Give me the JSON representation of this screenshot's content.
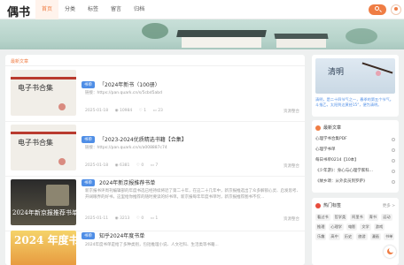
{
  "header": {
    "logo": "偶书",
    "nav": [
      "首页",
      "分类",
      "标签",
      "留言",
      "归档"
    ],
    "search_icon": "search-icon",
    "avatar_icon": "user-icon",
    "accent": "#ef7d44"
  },
  "main": {
    "section_title": "最新文章",
    "posts": [
      {
        "thumb_text": "电子书合集",
        "category": "书单",
        "title": "「2024年新书（100册）",
        "desc": "链接：https://pan.quark.cn/s/5cbd5abd",
        "date": "2025-01-18",
        "views": "10984",
        "likes": "1",
        "comments": "23",
        "source": "资源整合"
      },
      {
        "thumb_text": "电子书合集",
        "category": "书单",
        "title": "「2023-2024优质精选书籍【合集】",
        "desc": "链接：https://pan.quark.cn/s/a008887c74",
        "date": "2025-01-18",
        "views": "6381",
        "likes": "0",
        "comments": "7",
        "source": "资源整合"
      },
      {
        "thumb_text": "2024年新京报推荐书单",
        "category": "书单",
        "title": "2024年新京报推荐书单",
        "desc": "新京报书评周刊编辑部的年度书选已经持续将近了第二十年，在这二十几年中，新京报推选出了众多解锁心灵、启发思考、开阔眼界的好书，这里给你推荐的随时要读的好书单。新京报每年年度书单时，新京报推荐图书不仅...",
        "date": "2025-01-11",
        "views": "3213",
        "likes": "0",
        "comments": "1",
        "source": "资源整合"
      },
      {
        "thumb_text": "2024 年度书单",
        "category": "书单",
        "title": "知乎2024年度书单",
        "desc": "2024年度书单是给了多种类别，包括推理小说、人文社科、生活类等书籍...",
        "date": "",
        "views": "",
        "likes": "",
        "comments": "",
        "source": ""
      }
    ]
  },
  "sidebar": {
    "promo": {
      "image_word": "清明",
      "text": "清明，是二十四节气之一，春季的第五个节气。斗指乙，太阳到达黄经15°，便为清明。"
    },
    "newest": {
      "title": "最新文章",
      "items": [
        "心理学书合集PDF",
        "心理学书单",
        "每日书单0214【10本】",
        "《少年游》：身心与心理学家科...",
        "《故乡颂：从外卖员到罗萨》"
      ]
    },
    "tags": {
      "title": "热门标签",
      "more": "更多 >",
      "items": [
        "看过书",
        "哲学类",
        "阿里书",
        "青书",
        "运动",
        "推理",
        "心理学",
        "电影",
        "文学",
        "游戏",
        "乐趣",
        "高中",
        "历史",
        "旅游",
        "漫画",
        "书单"
      ]
    }
  }
}
